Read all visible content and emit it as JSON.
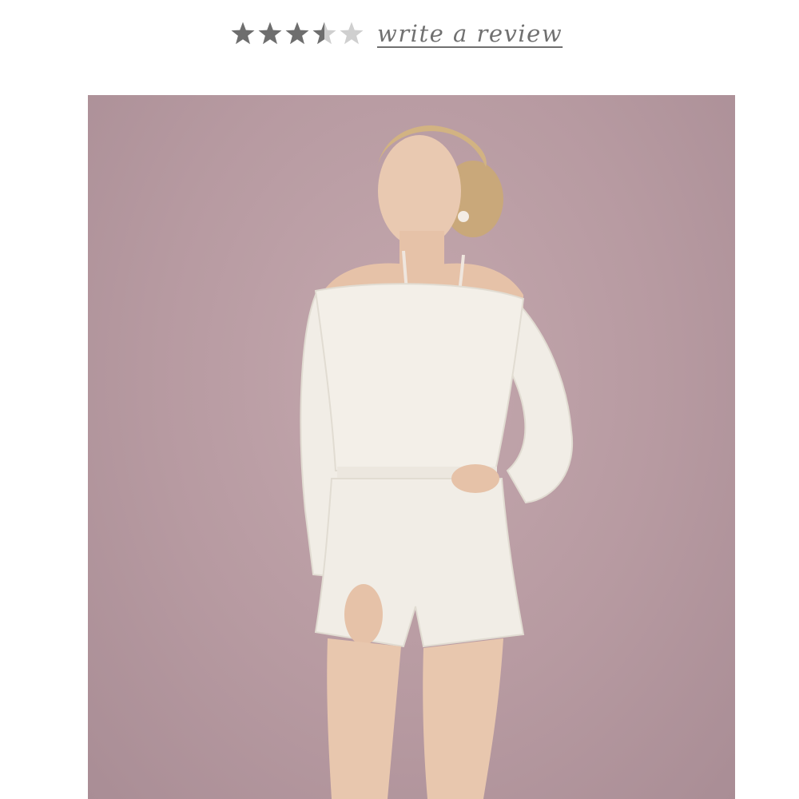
{
  "rating": {
    "stars_filled": 3.5,
    "stars_total": 5,
    "filled_color": "#6e6e6e",
    "empty_color": "#cfcfcf",
    "star_icons": [
      "star-icon",
      "star-icon",
      "star-icon",
      "star-half-icon",
      "star-empty-icon"
    ]
  },
  "review_link": {
    "label": "write a review",
    "color": "#707070"
  },
  "product_image": {
    "subject": "model-wearing-white-off-shoulder-romper",
    "background_color": "#b89ca3",
    "garment_color": "#f1ede6"
  }
}
